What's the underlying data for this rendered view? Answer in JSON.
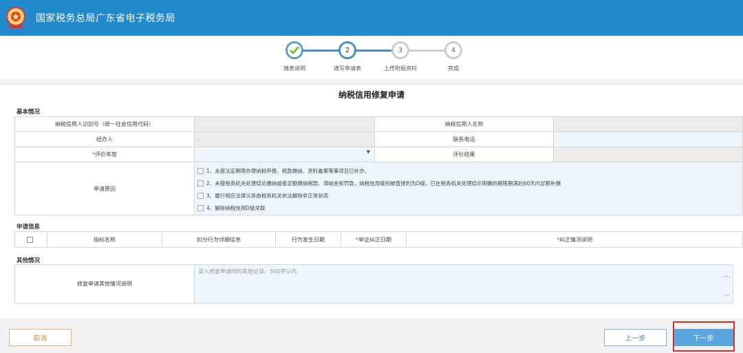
{
  "header": {
    "title": "国家税务总局广东省电子税务局",
    "logo_icon": "tax-emblem-icon",
    "bg_color": "#2289cc"
  },
  "steps": [
    {
      "number": "✓",
      "label": "填表说明",
      "state": "done"
    },
    {
      "number": "2",
      "label": "填写申请表",
      "state": "active"
    },
    {
      "number": "3",
      "label": "上传附报资料",
      "state": "pending"
    },
    {
      "number": "4",
      "label": "完成",
      "state": "pending"
    }
  ],
  "form": {
    "title": "纳税信用修复申请",
    "basic": {
      "section": "基本情况",
      "taxpayer_id_label": "纳税信用人识别号（统一社会信用代码）",
      "taxpayer_name_label": "纳税信用人名称",
      "handler_label": "经办人",
      "handler_value": ".",
      "phone_label": "联系电话",
      "eval_year_required": "*",
      "eval_year_label": "评价年度",
      "eval_result_label": "评价结果",
      "reason_label": "申请原因",
      "reasons": [
        "1、未按法定期限办理纳税申报、税款缴纳、资料备案等事项且已补办。",
        "2、未按税务机关处理结论缴纳或者足额缴纳税款、滞纳金和罚款，纳税信用级别被直接判为D级，已在税务机关处理结论明确的期限期满后60天内足额补缴",
        "3、履行相应法律义务由税务机关依法解除非正常状态",
        "4、解除纳税信用D级关联"
      ]
    },
    "apply": {
      "section": "申请信息",
      "columns": [
        {
          "text": "指标名称",
          "required": ""
        },
        {
          "text": "扣分行为详细信息",
          "required": ""
        },
        {
          "text": "行为发生日期",
          "required": ""
        },
        {
          "text": "举证纠正日期",
          "required": "*"
        },
        {
          "text": "纠正情况说明",
          "required": "*"
        }
      ]
    },
    "other": {
      "section": "其他情况",
      "label": "修复申请其他情况说明",
      "placeholder": "录入修复申请时的其他记录，500字以内"
    }
  },
  "footer": {
    "cancel": "取消",
    "prev": "上一步",
    "next": "下一步"
  },
  "colors": {
    "accent": "#5aa7e0",
    "highlight": "#d62b2b"
  }
}
